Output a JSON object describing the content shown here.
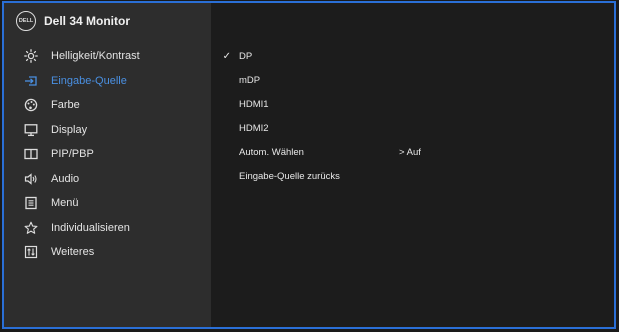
{
  "header": {
    "logo_text": "DELL",
    "title": "Dell  34 Monitor"
  },
  "sidebar": {
    "items": [
      {
        "label": "Helligkeit/Kontrast",
        "icon": "brightness-icon",
        "active": false
      },
      {
        "label": "Eingabe-Quelle",
        "icon": "input-source-icon",
        "active": true
      },
      {
        "label": "Farbe",
        "icon": "color-palette-icon",
        "active": false
      },
      {
        "label": "Display",
        "icon": "display-icon",
        "active": false
      },
      {
        "label": "PIP/PBP",
        "icon": "pip-pbp-icon",
        "active": false
      },
      {
        "label": "Audio",
        "icon": "audio-icon",
        "active": false
      },
      {
        "label": "Menü",
        "icon": "menu-icon",
        "active": false
      },
      {
        "label": "Individualisieren",
        "icon": "star-icon",
        "active": false
      },
      {
        "label": "Weiteres",
        "icon": "others-icon",
        "active": false
      }
    ]
  },
  "input_options": [
    {
      "label": "DP",
      "selected": true,
      "value": ""
    },
    {
      "label": "mDP",
      "selected": false,
      "value": ""
    },
    {
      "label": "HDMI1",
      "selected": false,
      "value": ""
    },
    {
      "label": "HDMI2",
      "selected": false,
      "value": ""
    },
    {
      "label": "Autom. Wählen",
      "selected": false,
      "value": "> Auf"
    },
    {
      "label": "Eingabe-Quelle zurücks",
      "selected": false,
      "value": ""
    }
  ],
  "check_glyph": "✓",
  "colors": {
    "accent": "#4a90e2",
    "border": "#2a6fd6"
  }
}
